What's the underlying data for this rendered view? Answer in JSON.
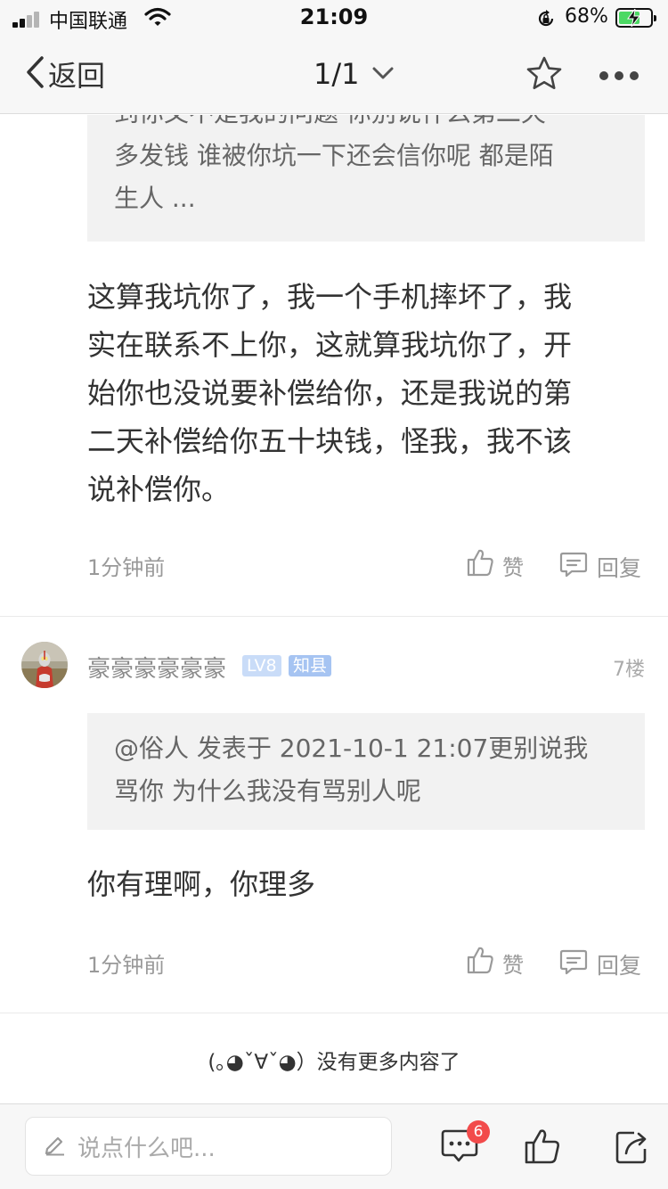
{
  "status_bar": {
    "carrier": "中国联通",
    "time": "21:09",
    "battery_percent": "68%",
    "battery_level": 0.68,
    "icons": [
      "signal-icon",
      "wifi-icon",
      "rotation-lock-icon",
      "battery-charging-icon"
    ]
  },
  "nav": {
    "back_label": "返回",
    "page_indicator": "1/1",
    "icons": [
      "chevron-left-icon",
      "chevron-down-icon",
      "star-icon",
      "more-icon"
    ]
  },
  "posts": [
    {
      "quote_lines": [
        "到你文不是我的问题 你别说什么第二天",
        "多发钱 谁被你坑一下还会信你呢 都是陌",
        "生人 ..."
      ],
      "body_lines": [
        "这算我坑你了，我一个手机摔坏了，我",
        "实在联系不上你，这就算我坑你了，开",
        "始你也没说要补偿给你，还是我说的第",
        "二天补偿给你五十块钱，怪我，我不该",
        "说补偿你。"
      ],
      "time": "1分钟前",
      "like_label": "赞",
      "reply_label": "回复"
    },
    {
      "username": "豪豪豪豪豪豪",
      "level": "LV8",
      "title_badge": "知县",
      "floor": "7楼",
      "quote_lines": [
        "@俗人 发表于 2021-10-1 21:07更别说我",
        "骂你 为什么我没有骂别人呢"
      ],
      "body_lines": [
        "你有理啊，你理多"
      ],
      "time": "1分钟前",
      "like_label": "赞",
      "reply_label": "回复"
    }
  ],
  "end_message": "(｡◕ˇ∀ˇ◕）没有更多内容了",
  "bottom_bar": {
    "input_placeholder": "说点什么吧...",
    "comment_count": "6",
    "icons": [
      "pencil-icon",
      "comments-icon",
      "like-icon",
      "share-icon"
    ]
  },
  "colors": {
    "bar_background": "#f7f7f7",
    "quote_background": "#f2f2f2",
    "badge_level": "#c9dcf8",
    "badge_title": "#a6c4f2",
    "count_badge": "#f24b4b"
  }
}
